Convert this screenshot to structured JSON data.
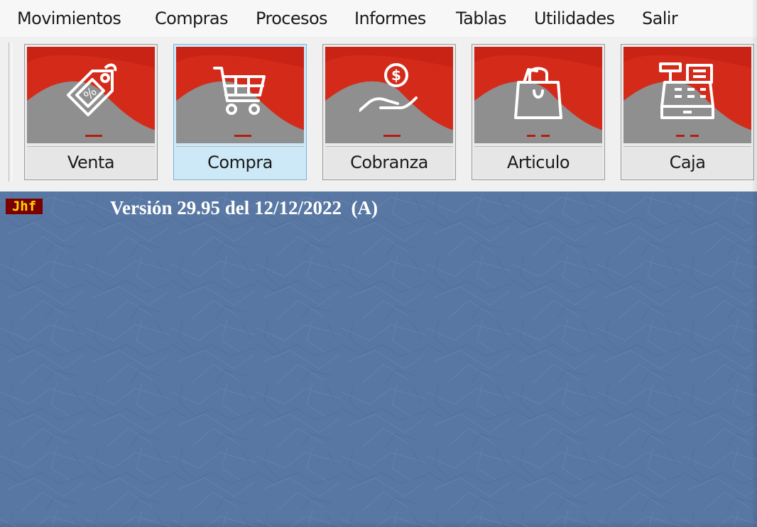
{
  "menu": [
    {
      "label": "Movimientos"
    },
    {
      "label": "Compras"
    },
    {
      "label": "Procesos"
    },
    {
      "label": "Informes"
    },
    {
      "label": "Tablas"
    },
    {
      "label": "Utilidades"
    },
    {
      "label": "Salir"
    }
  ],
  "toolbar": {
    "buttons": [
      {
        "label": "Venta",
        "icon": "price-tag-icon",
        "selected": false
      },
      {
        "label": "Compra",
        "icon": "shopping-cart-icon",
        "selected": true
      },
      {
        "label": "Cobranza",
        "icon": "hand-coin-icon",
        "selected": false
      },
      {
        "label": "Articulo",
        "icon": "shopping-bag-icon",
        "selected": false
      },
      {
        "label": "Caja",
        "icon": "cash-register-icon",
        "selected": false
      }
    ]
  },
  "workspace": {
    "badge": "Jhf",
    "version_text": "Versión 29.95 del 12/12/2022  (A)"
  },
  "colors": {
    "tile_red": "#d42a1a",
    "tile_gray": "#8e8e8e",
    "workspace_blue": "#5877a3",
    "badge_bg": "#7a0000",
    "badge_fg": "#ffd400",
    "selected_bg": "#cde8f7"
  }
}
